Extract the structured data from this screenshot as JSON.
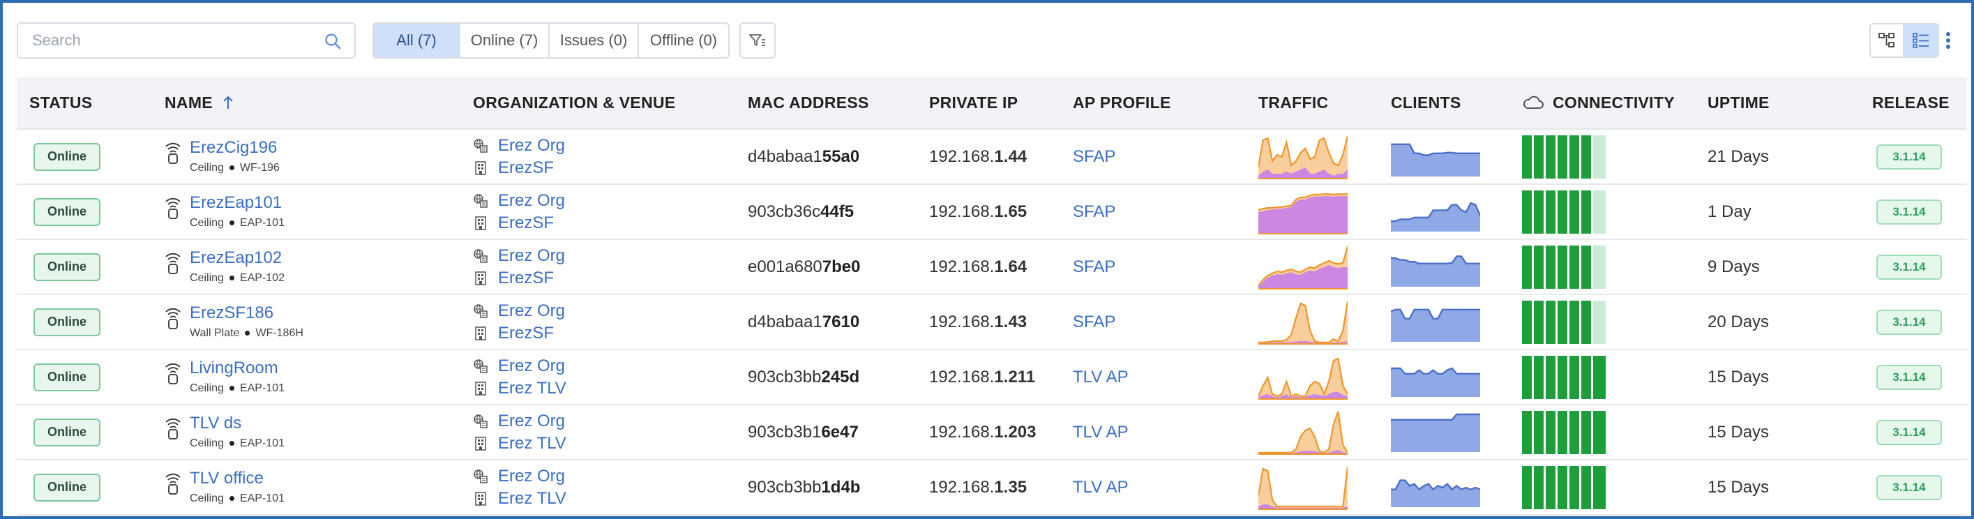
{
  "search": {
    "placeholder": "Search"
  },
  "filters": [
    {
      "label": "All (7)",
      "active": true
    },
    {
      "label": "Online (7)",
      "active": false
    },
    {
      "label": "Issues (0)",
      "active": false
    },
    {
      "label": "Offline (0)",
      "active": false
    }
  ],
  "icons": {
    "search": "search-icon",
    "filter": "filter-icon",
    "topology_view": "topology-icon",
    "list_view": "list-view-icon",
    "more": "kebab-menu-icon",
    "ap": "wifi-ap-icon",
    "org": "organization-icon",
    "venue": "building-icon",
    "connectivity": "cloud-icon",
    "sort": "sort-ascending-icon"
  },
  "colors": {
    "accent": "#3a6fc3",
    "online_badge_bg": "#e8f6ee",
    "release_text": "#2e9e5c",
    "traffic_orange": "#f2a54a",
    "traffic_purple": "#c57fe9",
    "clients_blue": "#8fa9e6",
    "connectivity_green": "#1e9e3a"
  },
  "columns": {
    "status": "STATUS",
    "name": "NAME",
    "org_venue": "ORGANIZATION & VENUE",
    "mac": "MAC ADDRESS",
    "ip": "PRIVATE IP",
    "profile": "AP PROFILE",
    "traffic": "TRAFFIC",
    "clients": "CLIENTS",
    "connectivity": "CONNECTIVITY",
    "uptime": "UPTIME",
    "release": "RELEASE"
  },
  "rows": [
    {
      "status": "Online",
      "name": "ErezCig196",
      "mount": "Ceiling",
      "model": "WF-196",
      "org": "Erez Org",
      "venue": "ErezSF",
      "mac_prefix": "d4babaa1",
      "mac_suffix": "55a0",
      "ip_prefix": "192.168.",
      "ip_suffix": "1.44",
      "profile": "SFAP",
      "uptime": "21 Days",
      "release": "3.1.14",
      "connectivity_full": 6
    },
    {
      "status": "Online",
      "name": "ErezEap101",
      "mount": "Ceiling",
      "model": "EAP-101",
      "org": "Erez Org",
      "venue": "ErezSF",
      "mac_prefix": "903cb36c",
      "mac_suffix": "44f5",
      "ip_prefix": "192.168.",
      "ip_suffix": "1.65",
      "profile": "SFAP",
      "uptime": "1 Day",
      "release": "3.1.14",
      "connectivity_full": 6
    },
    {
      "status": "Online",
      "name": "ErezEap102",
      "mount": "Ceiling",
      "model": "EAP-102",
      "org": "Erez Org",
      "venue": "ErezSF",
      "mac_prefix": "e001a680",
      "mac_suffix": "7be0",
      "ip_prefix": "192.168.",
      "ip_suffix": "1.64",
      "profile": "SFAP",
      "uptime": "9 Days",
      "release": "3.1.14",
      "connectivity_full": 6
    },
    {
      "status": "Online",
      "name": "ErezSF186",
      "mount": "Wall Plate",
      "model": "WF-186H",
      "org": "Erez Org",
      "venue": "ErezSF",
      "mac_prefix": "d4babaa1",
      "mac_suffix": "7610",
      "ip_prefix": "192.168.",
      "ip_suffix": "1.43",
      "profile": "SFAP",
      "uptime": "20 Days",
      "release": "3.1.14",
      "connectivity_full": 6
    },
    {
      "status": "Online",
      "name": "LivingRoom",
      "mount": "Ceiling",
      "model": "EAP-101",
      "org": "Erez Org",
      "venue": "Erez TLV",
      "mac_prefix": "903cb3bb",
      "mac_suffix": "245d",
      "ip_prefix": "192.168.",
      "ip_suffix": "1.211",
      "profile": "TLV AP",
      "uptime": "15 Days",
      "release": "3.1.14",
      "connectivity_full": 7
    },
    {
      "status": "Online",
      "name": "TLV ds",
      "mount": "Ceiling",
      "model": "EAP-101",
      "org": "Erez Org",
      "venue": "Erez TLV",
      "mac_prefix": "903cb3b1",
      "mac_suffix": "6e47",
      "ip_prefix": "192.168.",
      "ip_suffix": "1.203",
      "profile": "TLV AP",
      "uptime": "15 Days",
      "release": "3.1.14",
      "connectivity_full": 7
    },
    {
      "status": "Online",
      "name": "TLV office",
      "mount": "Ceiling",
      "model": "EAP-101",
      "org": "Erez Org",
      "venue": "Erez TLV",
      "mac_prefix": "903cb3bb",
      "mac_suffix": "1d4b",
      "ip_prefix": "192.168.",
      "ip_suffix": "1.35",
      "profile": "TLV AP",
      "uptime": "15 Days",
      "release": "3.1.14",
      "connectivity_full": 7
    }
  ],
  "sparklines": {
    "traffic_orange": [
      [
        0.25,
        0.9,
        0.95,
        0.4,
        0.55,
        0.5,
        0.85,
        0.3,
        0.4,
        0.6,
        0.7,
        0.45,
        0.5,
        0.9,
        0.95,
        0.6,
        0.35,
        0.3,
        0.55,
        1.0
      ],
      [
        0.55,
        0.58,
        0.6,
        0.6,
        0.62,
        0.62,
        0.64,
        0.66,
        0.8,
        0.85,
        0.85,
        0.9,
        0.92,
        0.92,
        0.93,
        0.93,
        0.92,
        0.93,
        0.93,
        0.93
      ],
      [
        0.05,
        0.2,
        0.3,
        0.35,
        0.4,
        0.38,
        0.42,
        0.45,
        0.4,
        0.38,
        0.45,
        0.5,
        0.48,
        0.55,
        0.6,
        0.65,
        0.6,
        0.58,
        0.6,
        1.0
      ],
      [
        0.02,
        0.02,
        0.03,
        0.05,
        0.05,
        0.05,
        0.08,
        0.2,
        0.6,
        0.95,
        0.9,
        0.3,
        0.05,
        0.02,
        0.02,
        0.02,
        0.1,
        0.05,
        0.3,
        1.0
      ],
      [
        0.05,
        0.3,
        0.5,
        0.1,
        0.05,
        0.1,
        0.4,
        0.05,
        0.1,
        0.05,
        0.05,
        0.3,
        0.4,
        0.35,
        0.1,
        0.4,
        0.9,
        0.95,
        0.3,
        0.1
      ],
      [
        0.02,
        0.02,
        0.02,
        0.02,
        0.02,
        0.02,
        0.02,
        0.02,
        0.1,
        0.4,
        0.55,
        0.6,
        0.4,
        0.05,
        0.02,
        0.1,
        0.7,
        1.0,
        0.2,
        0.02
      ],
      [
        0.3,
        0.95,
        0.9,
        0.2,
        0.05,
        0.05,
        0.05,
        0.05,
        0.05,
        0.05,
        0.05,
        0.05,
        0.05,
        0.05,
        0.05,
        0.05,
        0.05,
        0.05,
        0.05,
        1.0
      ]
    ],
    "traffic_purple": [
      [
        0.05,
        0.15,
        0.2,
        0.1,
        0.1,
        0.1,
        0.15,
        0.1,
        0.15,
        0.2,
        0.25,
        0.1,
        0.1,
        0.15,
        0.2,
        0.1,
        0.05,
        0.1,
        0.1,
        0.2
      ],
      [
        0.5,
        0.52,
        0.55,
        0.56,
        0.58,
        0.58,
        0.6,
        0.62,
        0.75,
        0.8,
        0.8,
        0.85,
        0.87,
        0.87,
        0.88,
        0.88,
        0.87,
        0.88,
        0.88,
        0.88
      ],
      [
        0.03,
        0.15,
        0.25,
        0.3,
        0.33,
        0.32,
        0.35,
        0.38,
        0.33,
        0.32,
        0.38,
        0.42,
        0.4,
        0.46,
        0.5,
        0.55,
        0.5,
        0.48,
        0.5,
        0.5
      ],
      [
        0.01,
        0.01,
        0.01,
        0.02,
        0.02,
        0.02,
        0.02,
        0.03,
        0.04,
        0.05,
        0.05,
        0.04,
        0.02,
        0.01,
        0.01,
        0.01,
        0.02,
        0.02,
        0.03,
        0.05
      ],
      [
        0.02,
        0.08,
        0.1,
        0.05,
        0.02,
        0.05,
        0.1,
        0.02,
        0.05,
        0.02,
        0.02,
        0.08,
        0.1,
        0.08,
        0.05,
        0.1,
        0.15,
        0.15,
        0.08,
        0.05
      ],
      [
        0.01,
        0.01,
        0.01,
        0.01,
        0.01,
        0.01,
        0.01,
        0.01,
        0.02,
        0.05,
        0.06,
        0.06,
        0.05,
        0.02,
        0.01,
        0.02,
        0.06,
        0.08,
        0.03,
        0.01
      ],
      [
        0.05,
        0.1,
        0.1,
        0.05,
        0.02,
        0.02,
        0.02,
        0.02,
        0.02,
        0.02,
        0.02,
        0.02,
        0.02,
        0.02,
        0.02,
        0.02,
        0.02,
        0.02,
        0.02,
        0.05
      ]
    ],
    "clients": [
      [
        0.85,
        0.85,
        0.85,
        0.85,
        0.85,
        0.6,
        0.6,
        0.55,
        0.55,
        0.6,
        0.6,
        0.6,
        0.62,
        0.62,
        0.6,
        0.6,
        0.6,
        0.6,
        0.6,
        0.6
      ],
      [
        0.25,
        0.25,
        0.3,
        0.3,
        0.3,
        0.35,
        0.35,
        0.35,
        0.35,
        0.55,
        0.55,
        0.55,
        0.55,
        0.7,
        0.7,
        0.55,
        0.5,
        0.75,
        0.7,
        0.4
      ],
      [
        0.75,
        0.75,
        0.7,
        0.7,
        0.65,
        0.65,
        0.6,
        0.6,
        0.6,
        0.6,
        0.6,
        0.6,
        0.6,
        0.62,
        0.8,
        0.8,
        0.6,
        0.6,
        0.6,
        0.6
      ],
      [
        0.8,
        0.85,
        0.85,
        0.6,
        0.6,
        0.85,
        0.85,
        0.85,
        0.85,
        0.6,
        0.6,
        0.85,
        0.85,
        0.85,
        0.85,
        0.85,
        0.85,
        0.85,
        0.85,
        0.85
      ],
      [
        0.75,
        0.75,
        0.75,
        0.6,
        0.6,
        0.6,
        0.7,
        0.6,
        0.6,
        0.7,
        0.6,
        0.6,
        0.7,
        0.75,
        0.6,
        0.6,
        0.6,
        0.6,
        0.6,
        0.6
      ],
      [
        0.85,
        0.85,
        0.85,
        0.85,
        0.85,
        0.85,
        0.85,
        0.85,
        0.85,
        0.85,
        0.85,
        0.85,
        0.85,
        0.85,
        1.0,
        1.0,
        1.0,
        1.0,
        1.0,
        1.0
      ],
      [
        0.45,
        0.45,
        0.7,
        0.7,
        0.55,
        0.6,
        0.45,
        0.55,
        0.6,
        0.45,
        0.55,
        0.5,
        0.6,
        0.45,
        0.55,
        0.45,
        0.5,
        0.45,
        0.5,
        0.45
      ]
    ]
  }
}
